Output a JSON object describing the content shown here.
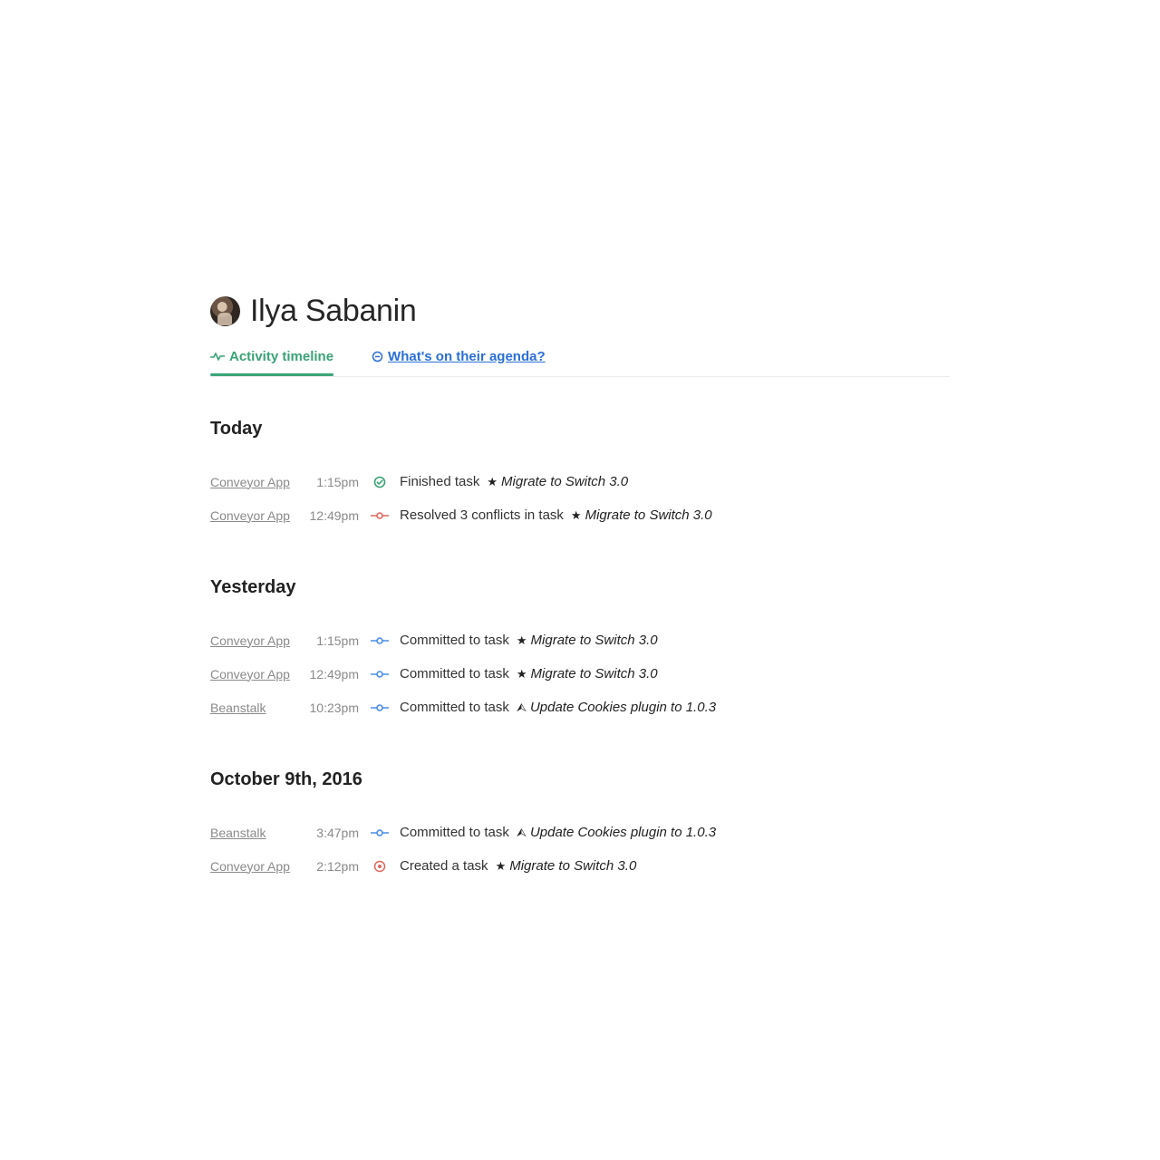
{
  "profile": {
    "name": "Ilya Sabanin"
  },
  "tabs": {
    "activity_label": "Activity timeline",
    "agenda_label": "What's on their agenda?"
  },
  "colors": {
    "accent_green": "#3aa377",
    "link_blue": "#2a6fd6",
    "conflict_red": "#e0675a",
    "commit_blue": "#4a8ee8"
  },
  "days": [
    {
      "label": "Today",
      "items": [
        {
          "source": "Conveyor App",
          "time": "1:15pm",
          "icon": "check-circle-icon",
          "action": "Finished task",
          "task_icon": "star-icon",
          "task": "Migrate to Switch 3.0"
        },
        {
          "source": "Conveyor App",
          "time": "12:49pm",
          "icon": "commit-red-icon",
          "action": "Resolved 3 conflicts in task",
          "task_icon": "star-icon",
          "task": "Migrate to Switch 3.0"
        }
      ]
    },
    {
      "label": "Yesterday",
      "items": [
        {
          "source": "Conveyor App",
          "time": "1:15pm",
          "icon": "commit-blue-icon",
          "action": "Committed to task",
          "task_icon": "star-icon",
          "task": "Migrate to Switch 3.0"
        },
        {
          "source": "Conveyor App",
          "time": "12:49pm",
          "icon": "commit-blue-icon",
          "action": "Committed to task",
          "task_icon": "star-icon",
          "task": "Migrate to Switch 3.0"
        },
        {
          "source": "Beanstalk",
          "time": "10:23pm",
          "icon": "commit-blue-icon",
          "action": "Committed to task",
          "task_icon": "circle-arrow-icon",
          "task": "Update Cookies plugin to 1.0.3"
        }
      ]
    },
    {
      "label": "October 9th, 2016",
      "items": [
        {
          "source": "Beanstalk",
          "time": "3:47pm",
          "icon": "commit-blue-icon",
          "action": "Committed to task",
          "task_icon": "circle-arrow-icon",
          "task": "Update Cookies plugin to 1.0.3"
        },
        {
          "source": "Conveyor App",
          "time": "2:12pm",
          "icon": "target-red-icon",
          "action": "Created a task",
          "task_icon": "star-icon",
          "task": "Migrate to Switch 3.0"
        }
      ]
    }
  ]
}
